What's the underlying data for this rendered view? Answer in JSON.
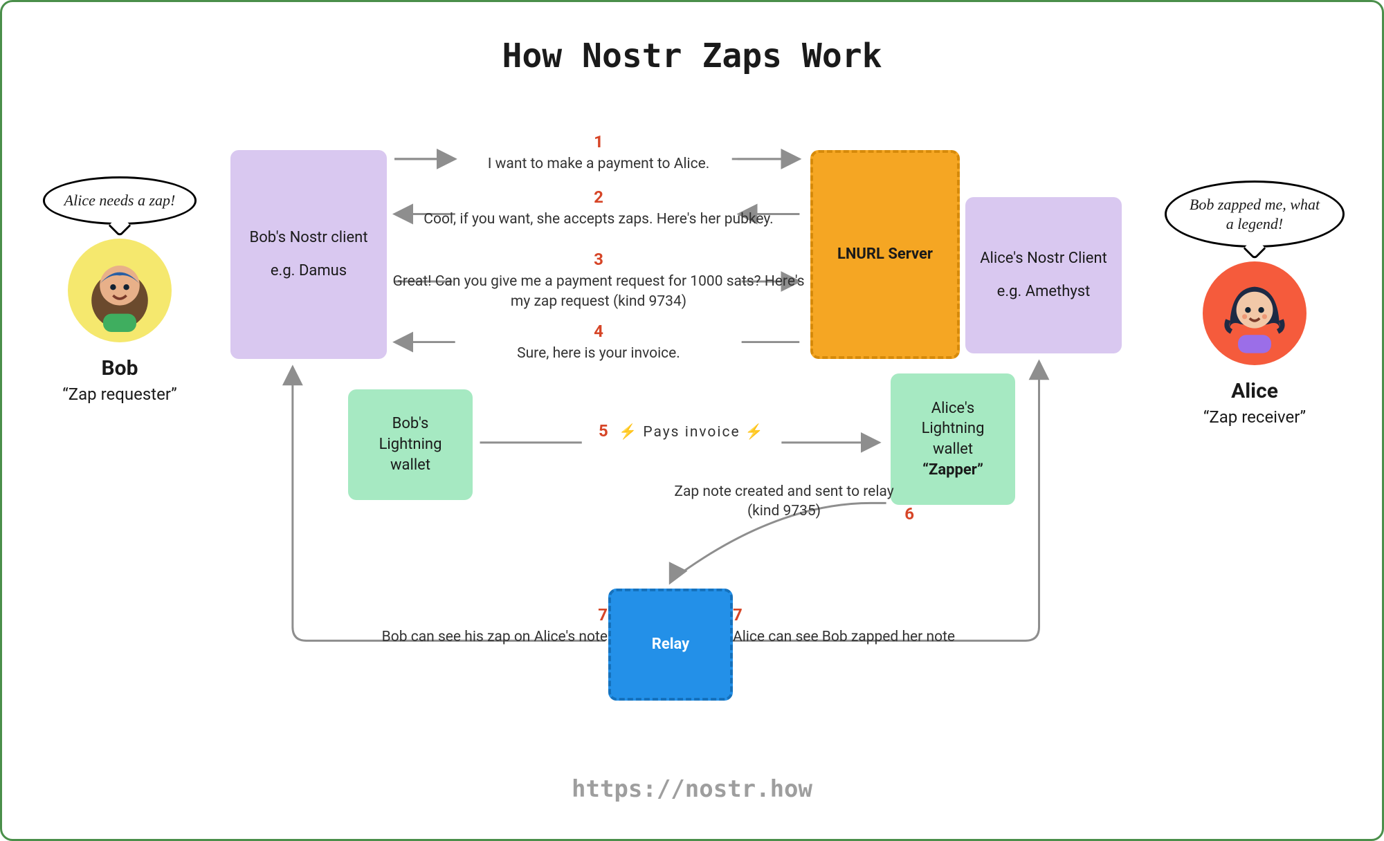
{
  "title": "How Nostr Zaps Work",
  "footer_url": "https://nostr.how",
  "actors": {
    "bob": {
      "name": "Bob",
      "role": "“Zap requester”",
      "bubble": "Alice needs a zap!"
    },
    "alice": {
      "name": "Alice",
      "role": "“Zap receiver”",
      "bubble": "Bob zapped me, what a legend!"
    }
  },
  "nodes": {
    "bob_client": {
      "line1": "Bob's Nostr client",
      "line2": "e.g. Damus"
    },
    "alice_client": {
      "line1": "Alice's Nostr Client",
      "line2": "e.g. Amethyst"
    },
    "lnurl": {
      "label": "LNURL Server"
    },
    "bob_wallet": {
      "line1": "Bob's",
      "line2": "Lightning",
      "line3": "wallet"
    },
    "alice_wallet": {
      "line1": "Alice's",
      "line2": "Lightning",
      "line3": "wallet",
      "line4": "“Zapper”"
    },
    "relay": {
      "label": "Relay"
    }
  },
  "steps": {
    "s1": {
      "n": "1",
      "text": "I want to make a payment to Alice."
    },
    "s2": {
      "n": "2",
      "text": "Cool, if you want, she accepts zaps. Here's her pubkey."
    },
    "s3": {
      "n": "3",
      "text": "Great! Can you give me a payment request for 1000 sats? Here's my zap request (kind 9734)"
    },
    "s4": {
      "n": "4",
      "text": "Sure, here is your invoice."
    },
    "s5": {
      "n": "5",
      "text": "⚡ Pays invoice ⚡"
    },
    "s6": {
      "n": "6",
      "text": "Zap note created and sent to relay (kind 9735)"
    },
    "s7l": {
      "n": "7",
      "text": "Bob can see his zap on Alice's note"
    },
    "s7r": {
      "n": "7",
      "text": "Alice can see Bob zapped her note"
    }
  },
  "colors": {
    "purple": "#d9c8f0",
    "orange": "#f5a623",
    "green": "#a6e9c2",
    "blue": "#2390e8",
    "accent_red": "#d64527",
    "arrow_grey": "#8e8e8e",
    "border": "#4a8f4a"
  }
}
